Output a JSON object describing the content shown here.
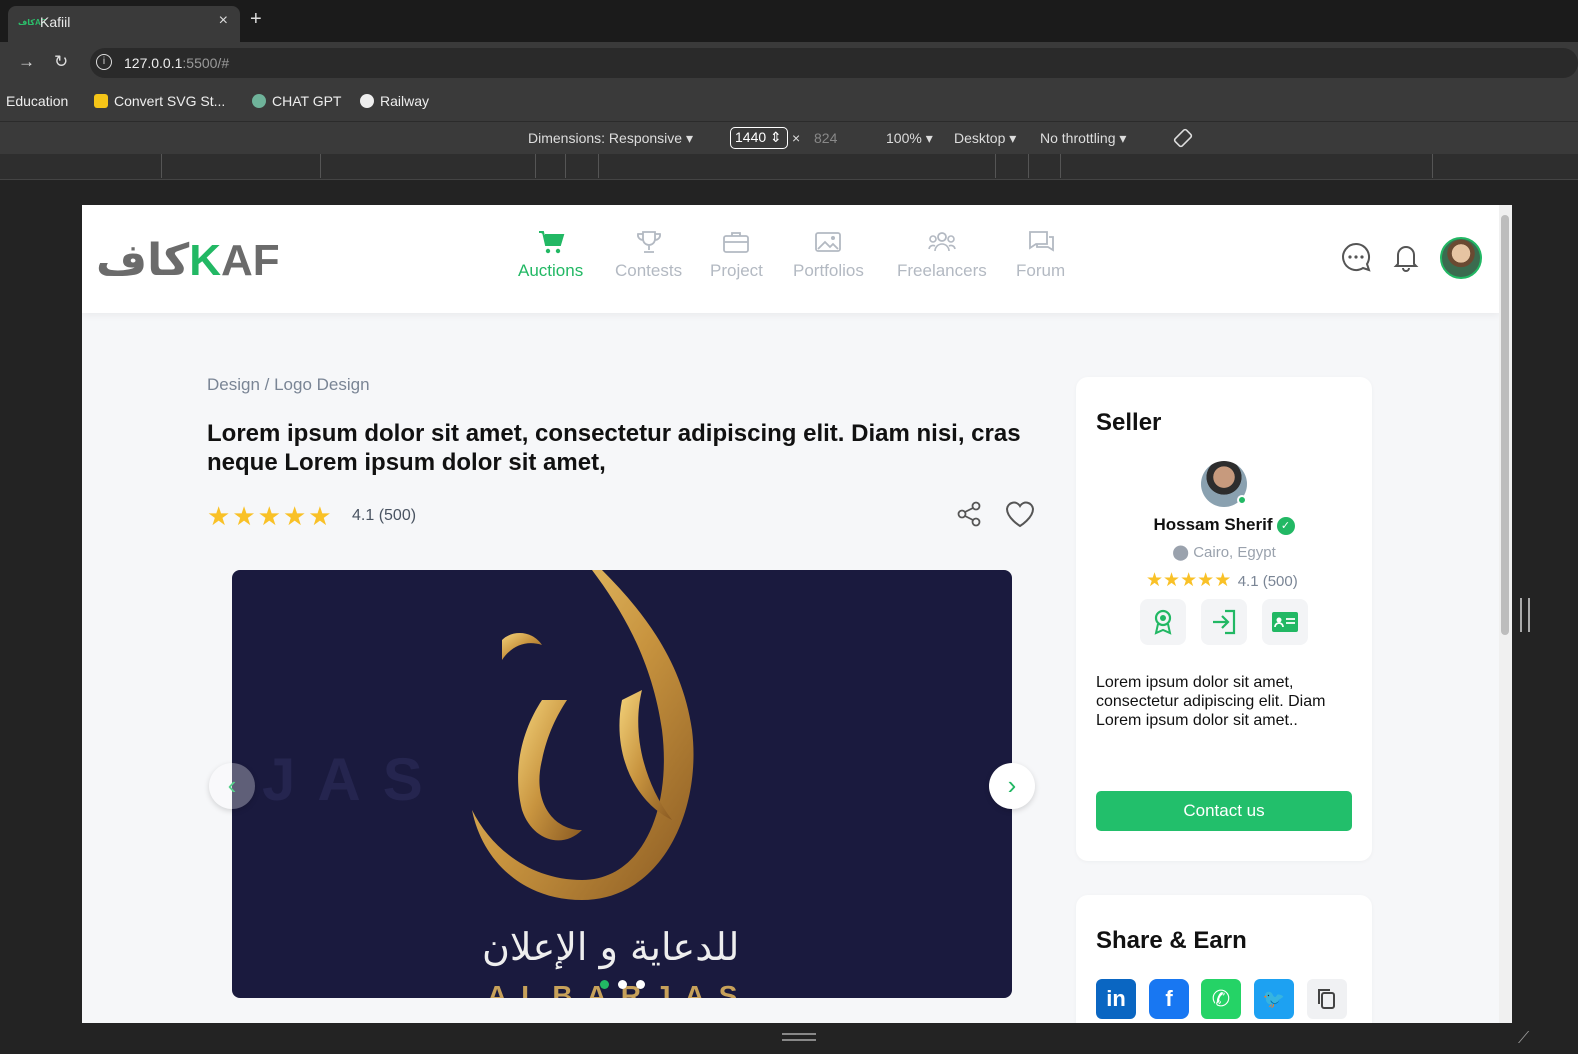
{
  "browser": {
    "tab_title": "Kafiil",
    "favicon_text": "كافAF",
    "close_symbol": "×",
    "new_tab_symbol": "+",
    "url_host": "127.0.0.1",
    "url_path": ":5500/#",
    "bookmarks": [
      "Education",
      "Convert SVG St...",
      "CHAT GPT",
      "Railway"
    ]
  },
  "devtools": {
    "dimensions": "Dimensions: Responsive ▾",
    "width": "1440 ⇕",
    "times": "×",
    "height": "824",
    "zoom": "100% ▾",
    "device": "Desktop ▾",
    "throttling": "No throttling ▾"
  },
  "header": {
    "logo_arabic": "كاف",
    "logo_k": "K",
    "logo_af": "AF",
    "nav": [
      {
        "label": "Auctions",
        "icon": "cart-icon",
        "active": true
      },
      {
        "label": "Contests",
        "icon": "trophy-icon",
        "active": false
      },
      {
        "label": "Project",
        "icon": "briefcase-icon",
        "active": false
      },
      {
        "label": "Portfolios",
        "icon": "image-icon",
        "active": false
      },
      {
        "label": "Freelancers",
        "icon": "users-icon",
        "active": false
      },
      {
        "label": "Forum",
        "icon": "chat-icon",
        "active": false
      }
    ]
  },
  "product": {
    "breadcrumb": "Design / Logo Design",
    "title": "Lorem ipsum dolor sit amet, consectetur adipiscing elit. Diam nisi, cras neque Lorem ipsum dolor sit amet,",
    "rating": "4.1 (500)",
    "stars": 5,
    "carousel": {
      "watermark": "JAS",
      "bottom_text": "للدعاية و الإعلان",
      "brand_text": "ALBARJAS",
      "arrow_left": "‹",
      "arrow_right": "›",
      "dot_count": 3,
      "active_dot": 0
    }
  },
  "seller": {
    "heading": "Seller",
    "name": "Hossam Sherif",
    "verified_symbol": "✓",
    "location": "Cairo, Egypt",
    "rating": "4.1 (500)",
    "description": "Lorem ipsum dolor sit amet, consectetur adipiscing elit. Diam Lorem ipsum dolor sit amet..",
    "contact_label": "Contact us"
  },
  "share": {
    "heading": "Share & Earn",
    "networks": [
      {
        "name": "linkedin",
        "glyph": "in",
        "color": "#0a66c2"
      },
      {
        "name": "facebook",
        "glyph": "f",
        "color": "#1877f2"
      },
      {
        "name": "whatsapp",
        "glyph": "✆",
        "color": "#25d366"
      },
      {
        "name": "twitter",
        "glyph": "🐦",
        "color": "#1da1f2"
      }
    ]
  },
  "colors": {
    "brand_green": "#22b864",
    "star": "#f9c127",
    "nav_inactive": "#b3b9c2"
  }
}
